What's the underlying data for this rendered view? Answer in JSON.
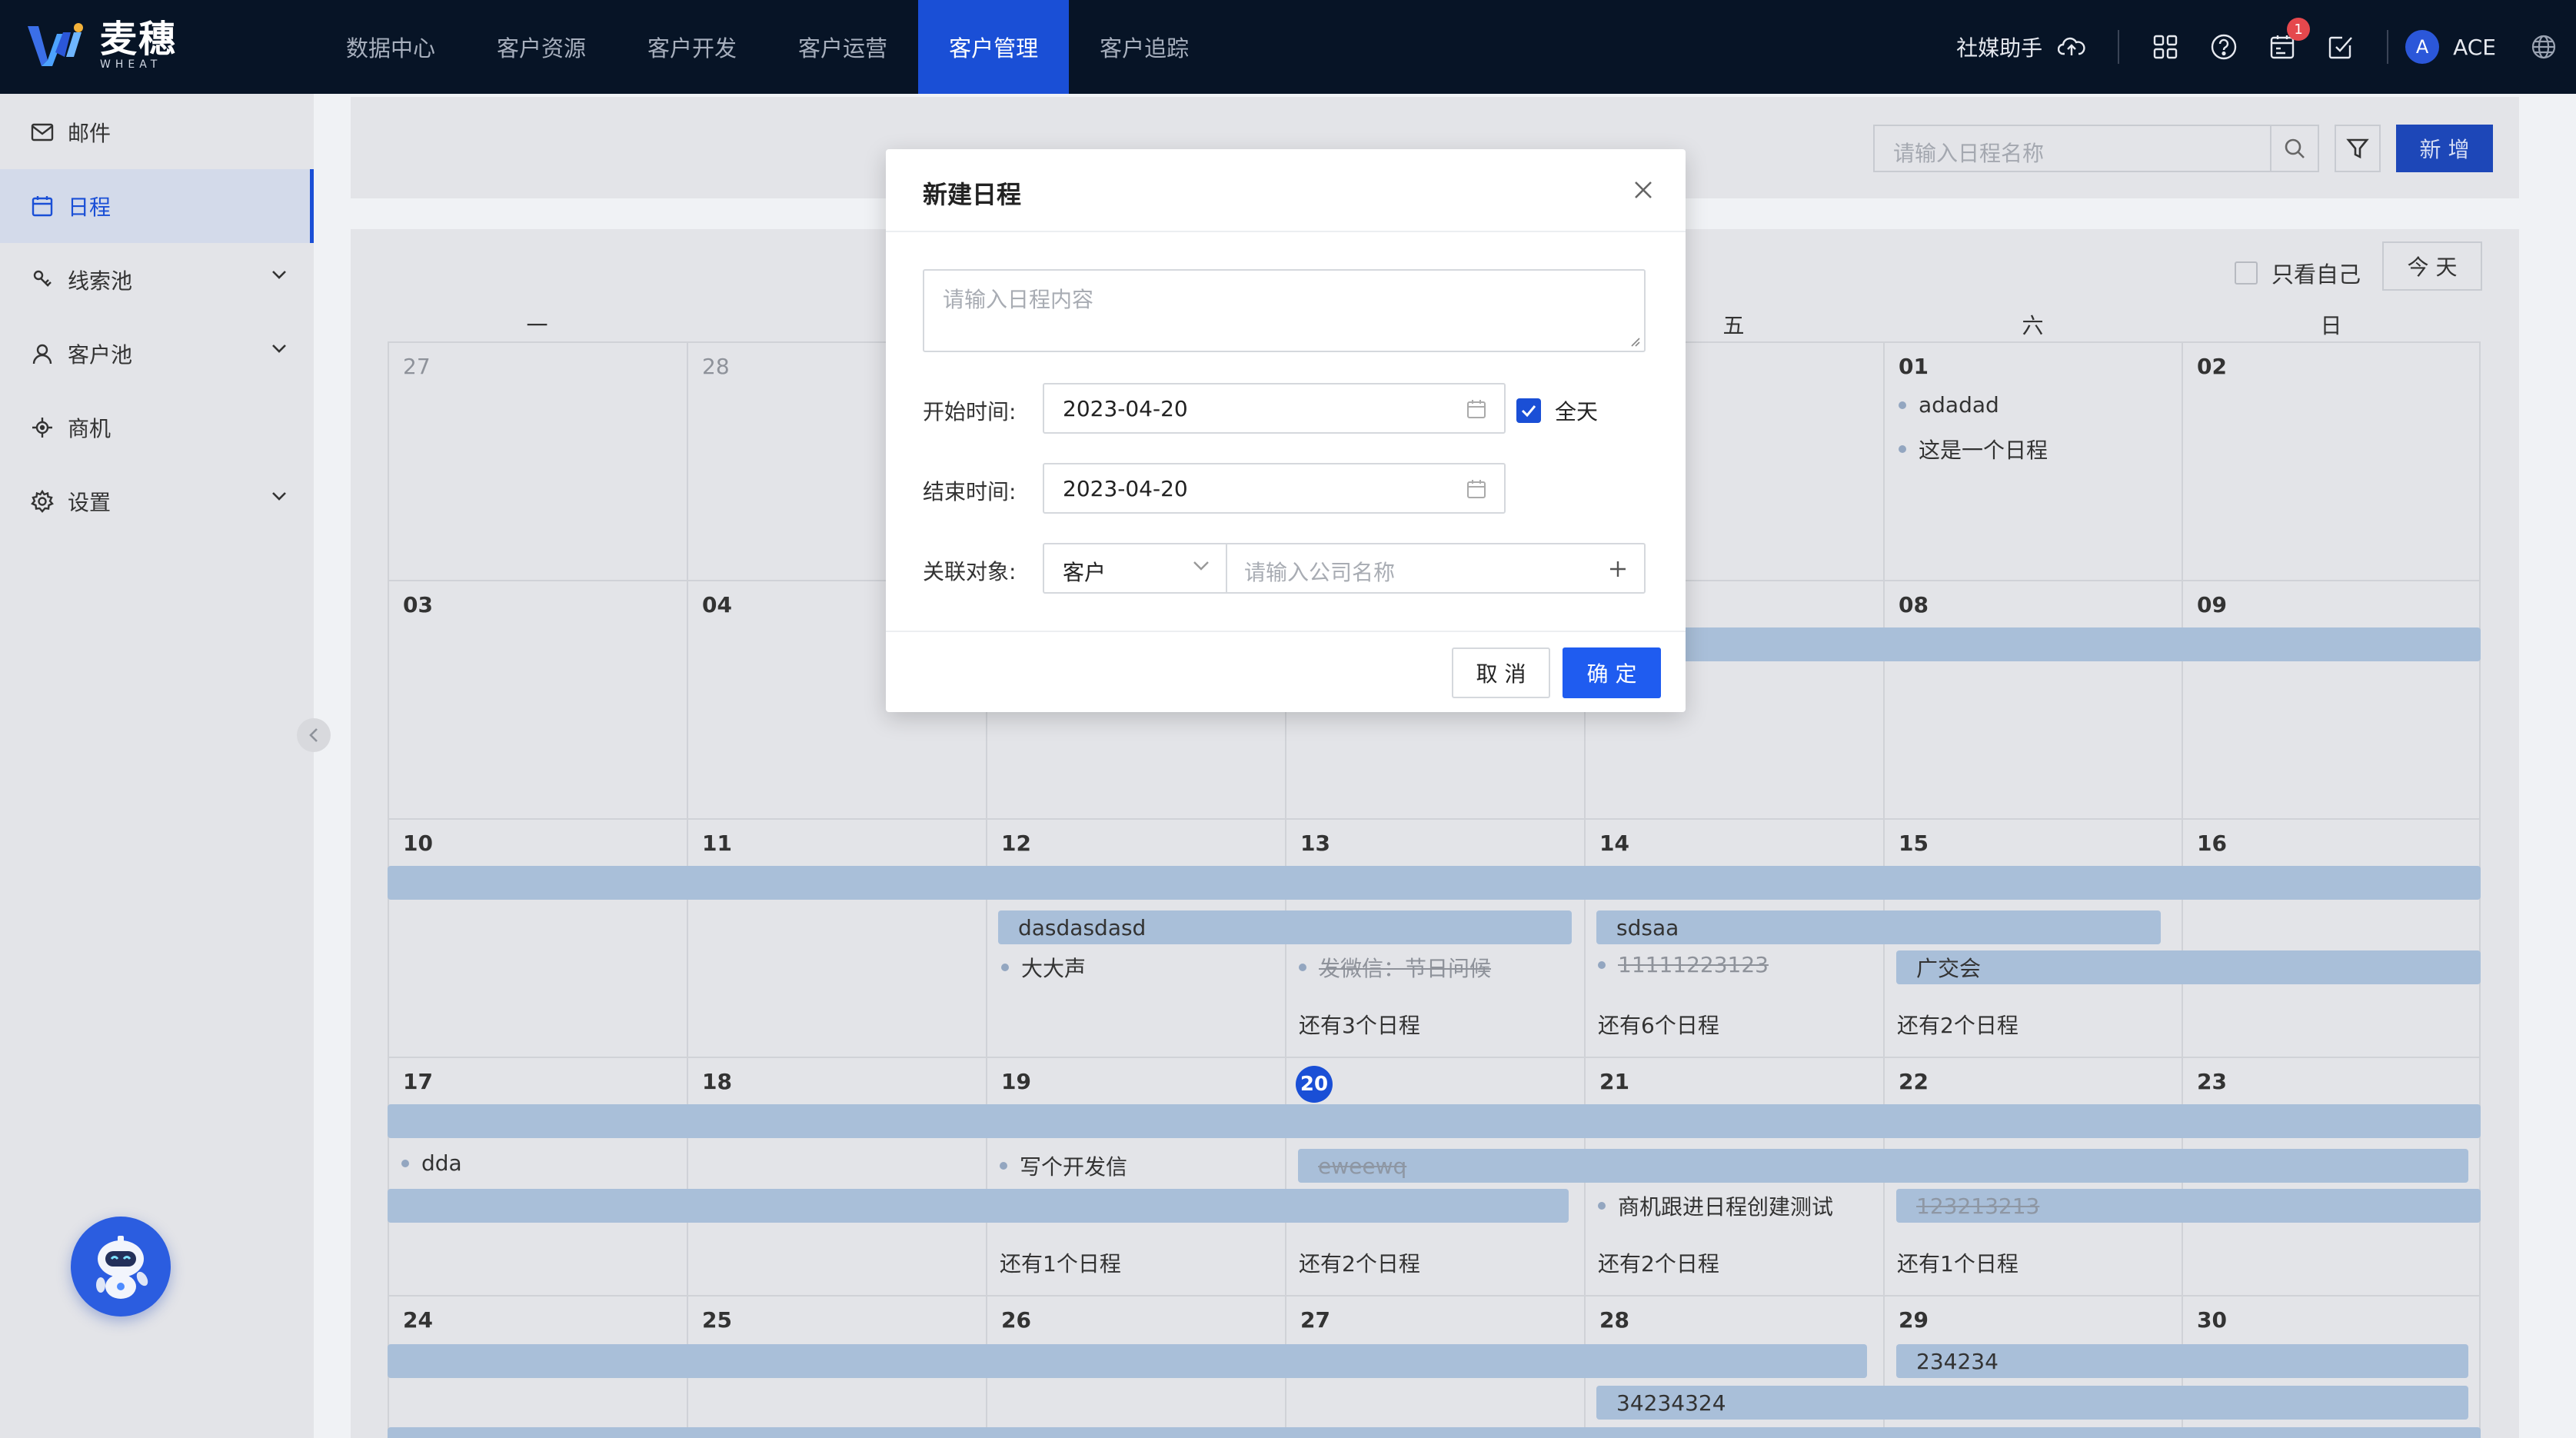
{
  "brand": {
    "name_cn": "麦穗",
    "name_en": "WHEAT",
    "accent": "#1a4fd6"
  },
  "nav": [
    "数据中心",
    "客户资源",
    "客户开发",
    "客户运营",
    "客户管理",
    "客户追踪"
  ],
  "nav_active": "客户管理",
  "header_right": {
    "assistant": "社媒助手",
    "notification_count": "1",
    "avatar_letter": "A",
    "user": "ACE"
  },
  "sidebar": {
    "items": [
      {
        "label": "邮件",
        "icon": "mail-icon"
      },
      {
        "label": "日程",
        "icon": "calendar-icon",
        "active": true
      },
      {
        "label": "线索池",
        "icon": "leads-icon",
        "expandable": true
      },
      {
        "label": "客户池",
        "icon": "user-icon",
        "expandable": true
      },
      {
        "label": "商机",
        "icon": "opportunity-icon"
      },
      {
        "label": "设置",
        "icon": "gear-icon",
        "expandable": true
      }
    ]
  },
  "toolbar": {
    "search_placeholder": "请输入日程名称",
    "add_label": "新 增"
  },
  "calendar": {
    "only_me_label": "只看自己",
    "today_label": "今 天",
    "weekdays": [
      "一",
      "",
      "",
      "",
      "五",
      "六",
      "日"
    ],
    "weeks": [
      {
        "days": [
          "27",
          "28",
          "",
          "",
          "",
          "01",
          "02"
        ]
      },
      {
        "days": [
          "03",
          "04",
          "",
          "",
          "",
          "08",
          "09"
        ]
      },
      {
        "days": [
          "10",
          "11",
          "12",
          "13",
          "14",
          "15",
          "16"
        ]
      },
      {
        "days": [
          "17",
          "18",
          "19",
          "20",
          "21",
          "22",
          "23"
        ]
      },
      {
        "days": [
          "24",
          "25",
          "26",
          "27",
          "28",
          "29",
          "30"
        ]
      }
    ],
    "events": {
      "w0_fri_1": "adadad",
      "w0_fri_2": "这是一个日程",
      "w2_bar1": "dasdasdasd",
      "w2_bar2": "sdsaa",
      "w2_bar3": "广交会",
      "w2_dot1": "大大声",
      "w2_dot2": "发微信：节日问候",
      "w2_dot3": "11111223123",
      "w2_more_wed": "还有3个日程",
      "w2_more_thu": "还有6个日程",
      "w2_more_fri": "还有2个日程",
      "w3_dot1": "dda",
      "w3_dot2": "写个开发信",
      "w3_bar1": "eweewq",
      "w3_dot3": "商机跟进日程创建测试",
      "w3_bar2": "123213213",
      "w3_more_tue": "还有1个日程",
      "w3_more_wed": "还有2个日程",
      "w3_more_thu": "还有2个日程",
      "w3_more_fri": "还有1个日程",
      "w4_bar1": "234234",
      "w4_bar2": "34234324"
    }
  },
  "modal": {
    "title": "新建日程",
    "content_placeholder": "请输入日程内容",
    "start_label": "开始时间:",
    "start_value": "2023-04-20",
    "allday_label": "全天",
    "end_label": "结束时间:",
    "end_value": "2023-04-20",
    "relation_label": "关联对象:",
    "relation_type": "客户",
    "company_placeholder": "请输入公司名称",
    "cancel": "取 消",
    "ok": "确 定"
  }
}
